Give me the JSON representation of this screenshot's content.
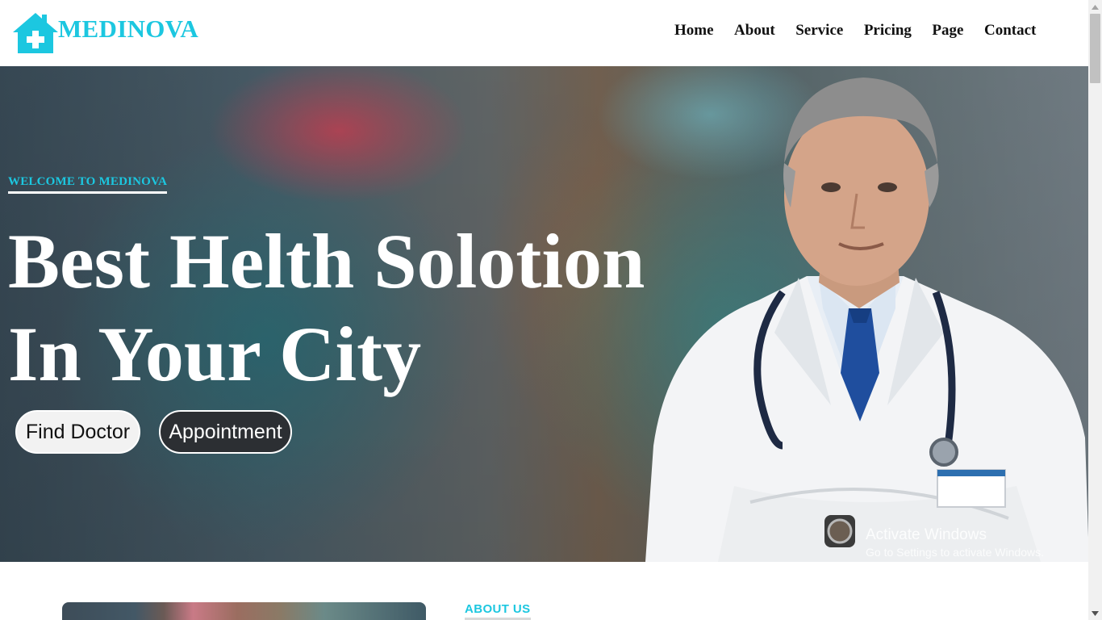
{
  "brand": {
    "name": "MEDINOVA",
    "color": "#1cc7e0",
    "icon": "house-medical-icon"
  },
  "nav": {
    "items": [
      {
        "label": "Home"
      },
      {
        "label": "About"
      },
      {
        "label": "Service"
      },
      {
        "label": "Pricing"
      },
      {
        "label": "Page"
      },
      {
        "label": "Contact"
      }
    ]
  },
  "hero": {
    "eyebrow": "WELCOME TO MEDINOVA",
    "headline_line1": "Best Helth Solotion",
    "headline_line2": "In Your City",
    "buttons": {
      "find_doctor": "Find Doctor",
      "appointment": "Appointment"
    }
  },
  "watermark": {
    "title": "Activate Windows",
    "subtitle": "Go to Settings to activate Windows."
  },
  "about": {
    "label": "ABOUT US"
  }
}
